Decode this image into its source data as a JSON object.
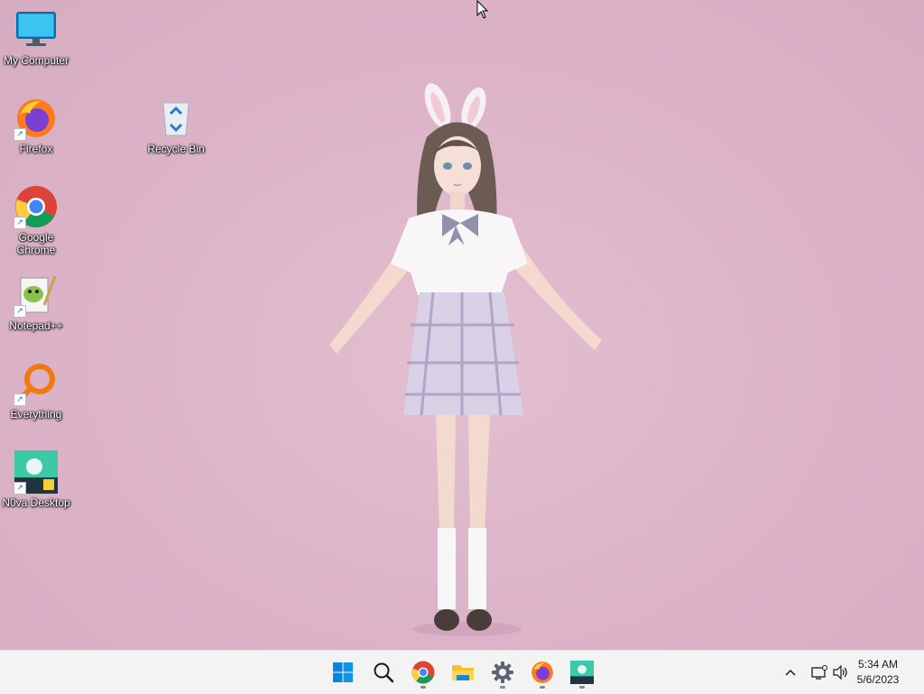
{
  "desktop": {
    "icons": [
      {
        "label": "My Computer",
        "icon": "monitor-icon",
        "shortcut": false
      },
      {
        "label": "Firefox",
        "icon": "firefox-icon",
        "shortcut": true
      },
      {
        "label": "Google\nChrome",
        "icon": "chrome-icon",
        "shortcut": true
      },
      {
        "label": "Notepad++",
        "icon": "notepadpp-icon",
        "shortcut": true
      },
      {
        "label": "Everything",
        "icon": "everything-icon",
        "shortcut": true
      },
      {
        "label": "N0va Desktop",
        "icon": "nova-desktop-icon",
        "shortcut": true
      },
      {
        "label": "Recycle Bin",
        "icon": "recycle-bin-icon",
        "shortcut": false
      }
    ],
    "wallpaper": "anime-girl-bunny-ears-pink-background",
    "background_color": "#dcb3c7"
  },
  "taskbar": {
    "apps": [
      {
        "name": "Start",
        "icon": "windows-start-icon",
        "running": false
      },
      {
        "name": "Search",
        "icon": "search-icon",
        "running": false
      },
      {
        "name": "Google Chrome",
        "icon": "chrome-icon",
        "running": true
      },
      {
        "name": "File Explorer",
        "icon": "file-explorer-icon",
        "running": false
      },
      {
        "name": "Settings",
        "icon": "settings-gear-icon",
        "running": true
      },
      {
        "name": "Firefox",
        "icon": "firefox-icon",
        "running": true
      },
      {
        "name": "N0va Desktop",
        "icon": "nova-desktop-icon",
        "running": true
      }
    ],
    "tray": {
      "chevron_icon": "chevron-up-icon",
      "network_icon": "network-icon",
      "volume_icon": "volume-icon"
    },
    "clock": {
      "time": "5:34 AM",
      "date": "5/6/2023"
    }
  },
  "colors": {
    "taskbar_bg": "#f3f3f3",
    "accent": "#0067c0"
  }
}
